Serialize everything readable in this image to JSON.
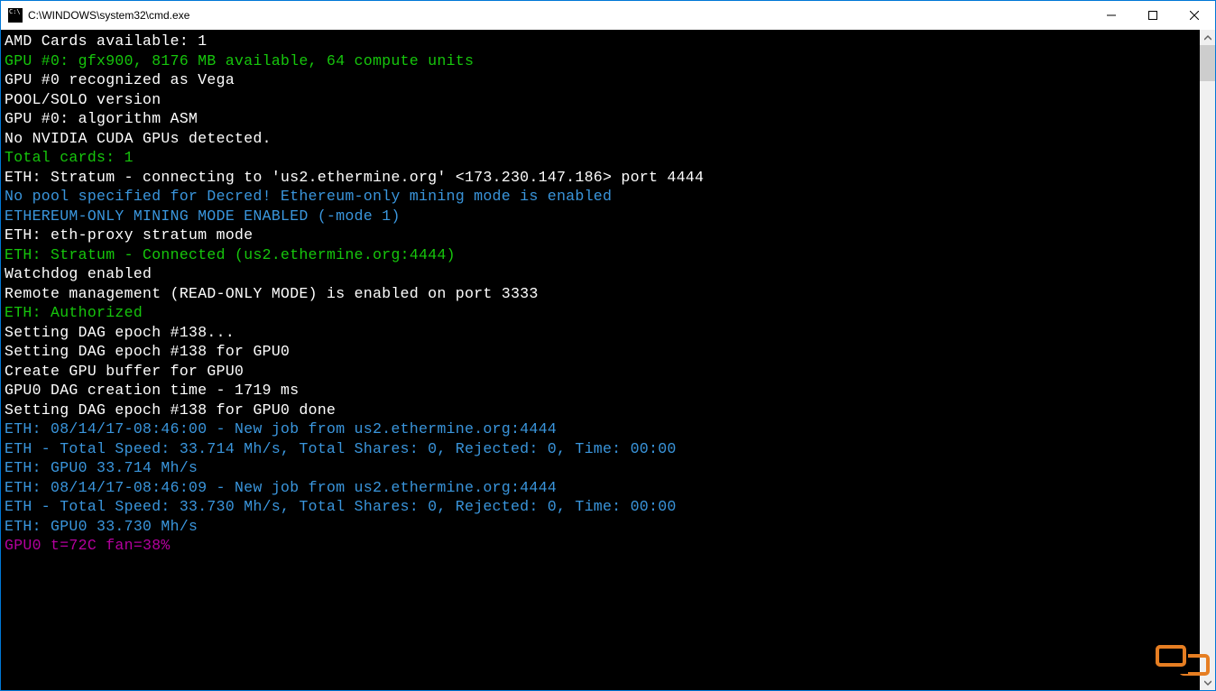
{
  "window": {
    "title": "C:\\WINDOWS\\system32\\cmd.exe"
  },
  "lines": [
    {
      "cls": "c-white",
      "text": ""
    },
    {
      "cls": "c-white",
      "text": "AMD Cards available: 1"
    },
    {
      "cls": "c-green",
      "text": "GPU #0: gfx900, 8176 MB available, 64 compute units"
    },
    {
      "cls": "c-white",
      "text": "GPU #0 recognized as Vega"
    },
    {
      "cls": "c-white",
      "text": "POOL/SOLO version"
    },
    {
      "cls": "c-white",
      "text": "GPU #0: algorithm ASM"
    },
    {
      "cls": "c-white",
      "text": "No NVIDIA CUDA GPUs detected."
    },
    {
      "cls": "c-green",
      "text": "Total cards: 1"
    },
    {
      "cls": "c-white",
      "text": "ETH: Stratum - connecting to 'us2.ethermine.org' <173.230.147.186> port 4444"
    },
    {
      "cls": "c-cyan",
      "text": "No pool specified for Decred! Ethereum-only mining mode is enabled"
    },
    {
      "cls": "c-cyan",
      "text": "ETHEREUM-ONLY MINING MODE ENABLED (-mode 1)"
    },
    {
      "cls": "c-white",
      "text": "ETH: eth-proxy stratum mode"
    },
    {
      "cls": "c-green",
      "text": "ETH: Stratum - Connected (us2.ethermine.org:4444)"
    },
    {
      "cls": "c-white",
      "text": "Watchdog enabled"
    },
    {
      "cls": "c-white",
      "text": "Remote management (READ-ONLY MODE) is enabled on port 3333"
    },
    {
      "cls": "c-white",
      "text": ""
    },
    {
      "cls": "c-green",
      "text": "ETH: Authorized"
    },
    {
      "cls": "c-white",
      "text": "Setting DAG epoch #138..."
    },
    {
      "cls": "c-white",
      "text": "Setting DAG epoch #138 for GPU0"
    },
    {
      "cls": "c-white",
      "text": "Create GPU buffer for GPU0"
    },
    {
      "cls": "c-white",
      "text": "GPU0 DAG creation time - 1719 ms"
    },
    {
      "cls": "c-white",
      "text": "Setting DAG epoch #138 for GPU0 done"
    },
    {
      "cls": "c-cyan",
      "text": "ETH: 08/14/17-08:46:00 - New job from us2.ethermine.org:4444"
    },
    {
      "cls": "c-cyan",
      "text": "ETH - Total Speed: 33.714 Mh/s, Total Shares: 0, Rejected: 0, Time: 00:00"
    },
    {
      "cls": "c-cyan",
      "text": "ETH: GPU0 33.714 Mh/s"
    },
    {
      "cls": "c-cyan",
      "text": "ETH: 08/14/17-08:46:09 - New job from us2.ethermine.org:4444"
    },
    {
      "cls": "c-cyan",
      "text": "ETH - Total Speed: 33.730 Mh/s, Total Shares: 0, Rejected: 0, Time: 00:00"
    },
    {
      "cls": "c-cyan",
      "text": "ETH: GPU0 33.730 Mh/s"
    },
    {
      "cls": "c-purple",
      "text": "GPU0 t=72C fan=38%"
    }
  ]
}
